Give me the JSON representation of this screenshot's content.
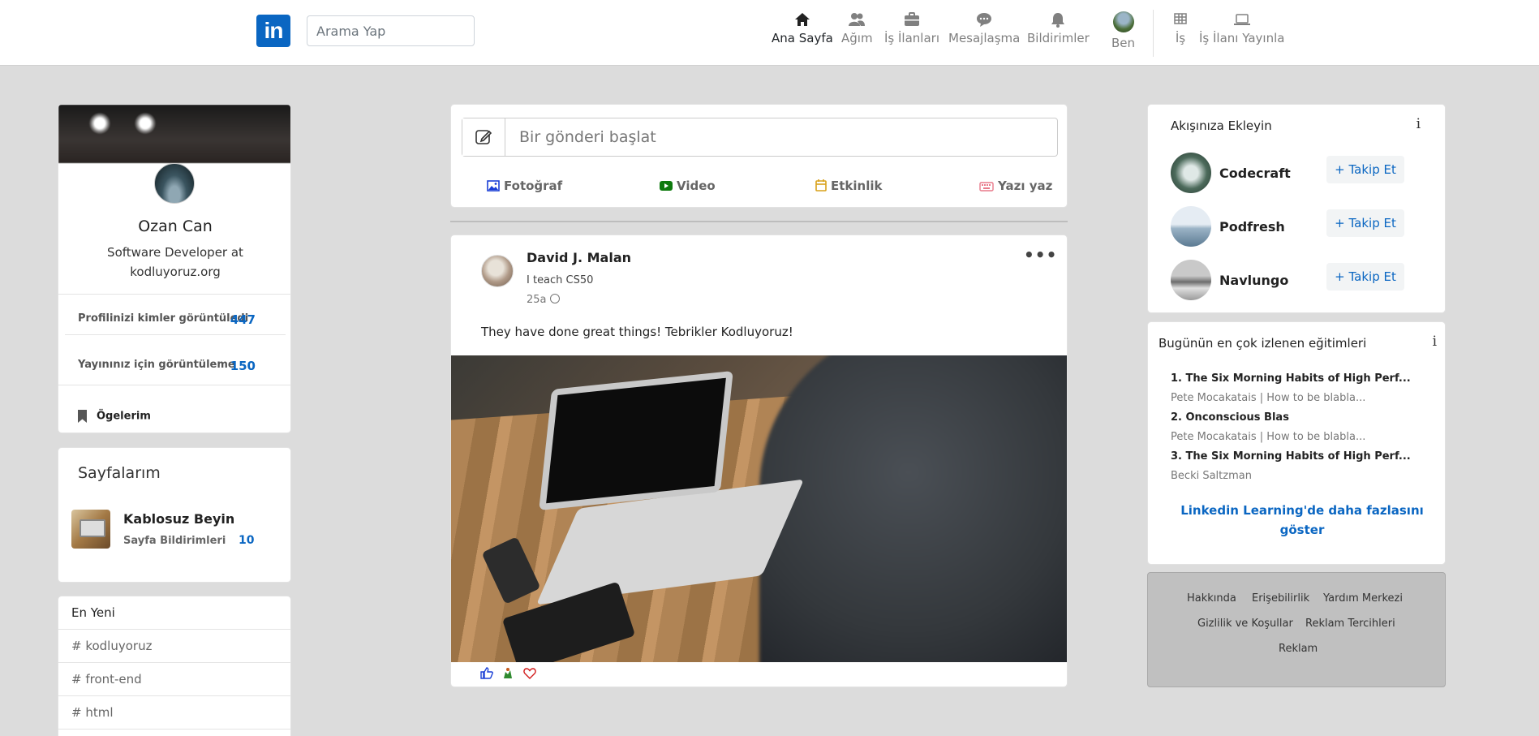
{
  "nav": {
    "logo": "in",
    "search_placeholder": "Arama Yap",
    "items": [
      {
        "label": "Ana Sayfa",
        "icon": "home-icon"
      },
      {
        "label": "Ağım",
        "icon": "network-icon"
      },
      {
        "label": "İş İlanları",
        "icon": "briefcase-icon"
      },
      {
        "label": "Mesajlaşma",
        "icon": "message-icon"
      },
      {
        "label": "Bildirimler",
        "icon": "bell-icon"
      },
      {
        "label": "Ben",
        "icon": "avatar"
      },
      {
        "label": "İş",
        "icon": "grid-icon"
      },
      {
        "label": "İş İlanı Yayınla",
        "icon": "laptop-icon"
      }
    ]
  },
  "profile": {
    "name": "Ozan Can",
    "title": "Software Developer at kodluyoruz.org",
    "stat1_label": "Profilinizi kimler görüntüledi",
    "stat1_value": "447",
    "stat2_label": "Yayınınız için görüntüleme",
    "stat2_value": "150",
    "items_label": "Ögelerim"
  },
  "pages": {
    "title": "Sayfalarım",
    "name": "Kablosuz Beyin",
    "sub_label": "Sayfa Bildirimleri",
    "sub_value": "10"
  },
  "latest": {
    "header": "En Yeni",
    "tags": [
      "# kodluyoruz",
      "# front-end",
      "# html"
    ]
  },
  "composer": {
    "placeholder": "Bir gönderi başlat",
    "actions": [
      "Fotoğraf",
      "Video",
      "Etkinlik",
      "Yazı yaz"
    ]
  },
  "post": {
    "author": "David J. Malan",
    "bio": "I teach CS50",
    "time": "25a",
    "more": "•••",
    "text": "They have done great things! Tebrikler Kodluyoruz!"
  },
  "feed_add": {
    "title": "Akışınıza Ekleyin",
    "info": "i",
    "follow_label": "+ Takip Et",
    "items": [
      "Codecraft",
      "Podfresh",
      "Navlungo"
    ]
  },
  "courses": {
    "title": "Bugünün en çok izlenen eğitimleri",
    "info": "i",
    "list": [
      {
        "title": "1. The Six Morning Habits of High Perf...",
        "sub": "Pete Mocakatais | How to be blabla..."
      },
      {
        "title": "2. Onconscious Blas",
        "sub": "Pete Mocakatais | How to be blabla..."
      },
      {
        "title": "3. The Six Morning Habits of High Perf...",
        "sub": "Becki Saltzman"
      }
    ],
    "more": "Linkedin Learning'de daha fazlasını göster"
  },
  "footer": {
    "links": [
      "Hakkında",
      "Erişebilirlik",
      "Yardım Merkezi",
      "Gizlilik ve Koşullar",
      "Reklam Tercihleri",
      "Reklam"
    ]
  },
  "colors": {
    "accent": "#0a66c2",
    "bg": "#dcdcdc"
  }
}
